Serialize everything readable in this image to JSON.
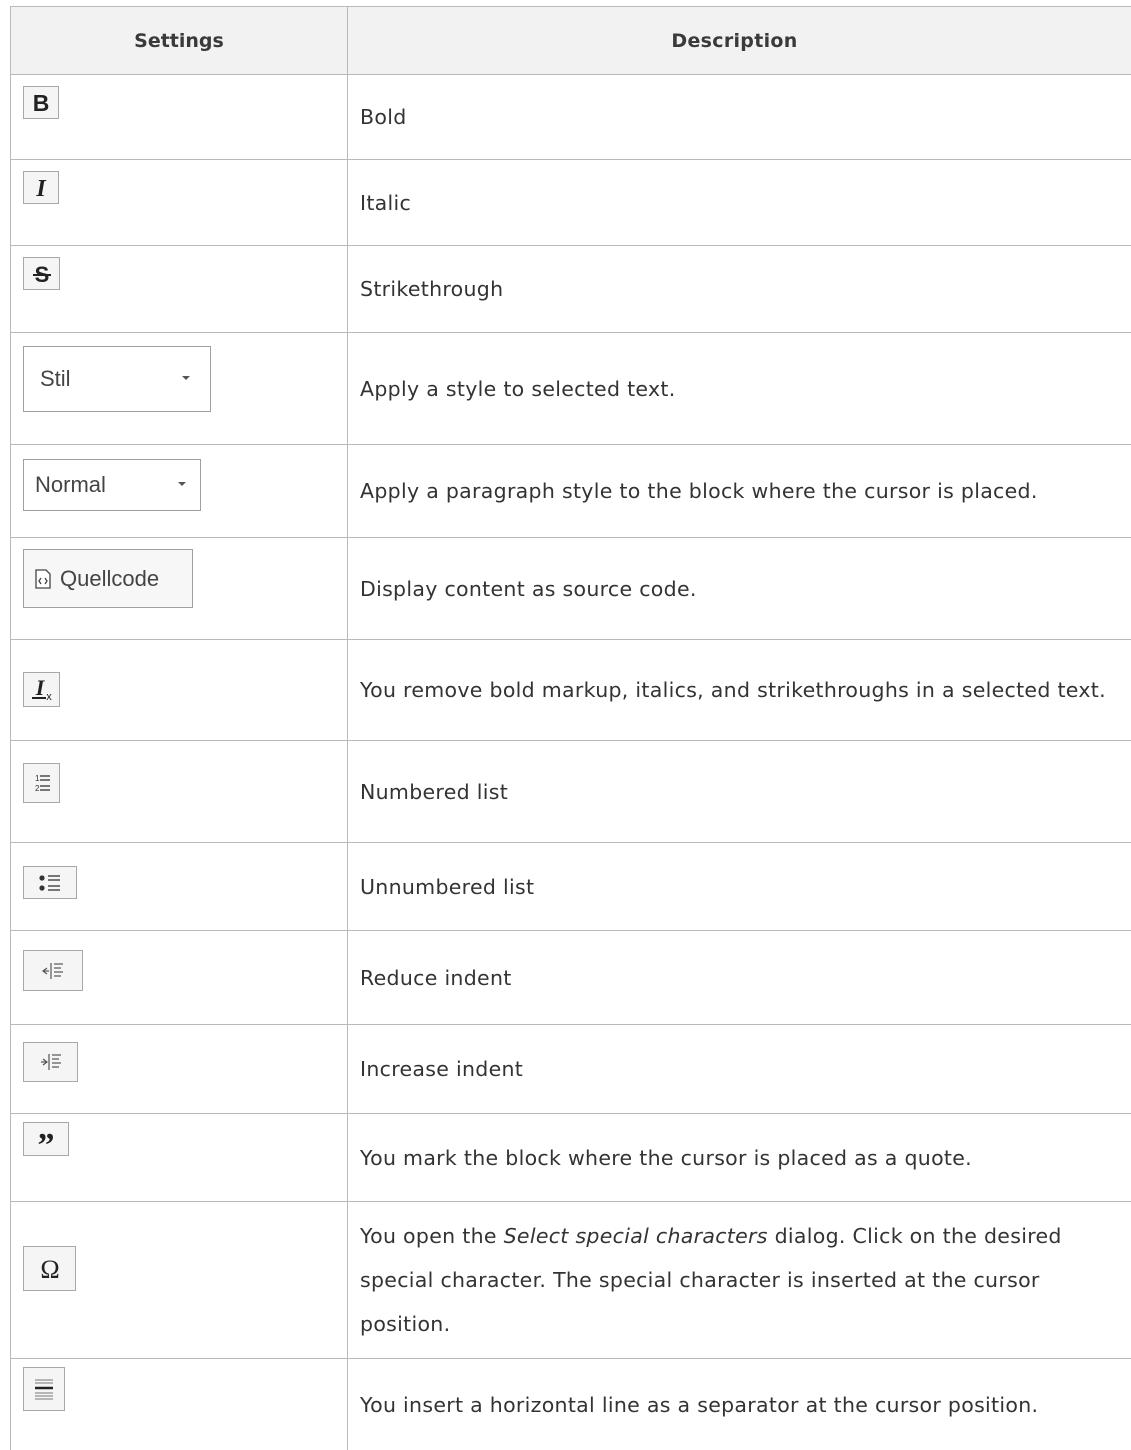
{
  "table": {
    "headers": {
      "settings": "Settings",
      "description": "Description"
    },
    "rows": [
      {
        "icon": "bold-icon",
        "description": "Bold"
      },
      {
        "icon": "italic-icon",
        "description": "Italic"
      },
      {
        "icon": "strikethrough-icon",
        "description": "Strikethrough"
      },
      {
        "icon": "style-dropdown",
        "control_label": "Stil",
        "description": "Apply a style to selected text."
      },
      {
        "icon": "format-dropdown",
        "control_label": "Normal",
        "description": "Apply a paragraph style to the block where the cursor is placed."
      },
      {
        "icon": "source-code-icon",
        "control_label": "Quellcode",
        "description": "Display content as source code."
      },
      {
        "icon": "remove-format-icon",
        "description": "You remove bold markup, italics, and strikethroughs in a selected text."
      },
      {
        "icon": "numbered-list-icon",
        "description": "Numbered list"
      },
      {
        "icon": "bulleted-list-icon",
        "description": "Unnumbered list"
      },
      {
        "icon": "outdent-icon",
        "description": "Reduce indent"
      },
      {
        "icon": "indent-icon",
        "description": "Increase indent"
      },
      {
        "icon": "blockquote-icon",
        "description": "You mark the block where the cursor is placed as a quote."
      },
      {
        "icon": "special-char-icon",
        "description_before": "You open the ",
        "description_em": "Select special characters",
        "description_after": " dialog. Click on the desired special character. The special character is inserted at the cursor position."
      },
      {
        "icon": "horizontal-line-icon",
        "description": "You insert a horizontal line as a separator at the cursor position."
      }
    ]
  }
}
